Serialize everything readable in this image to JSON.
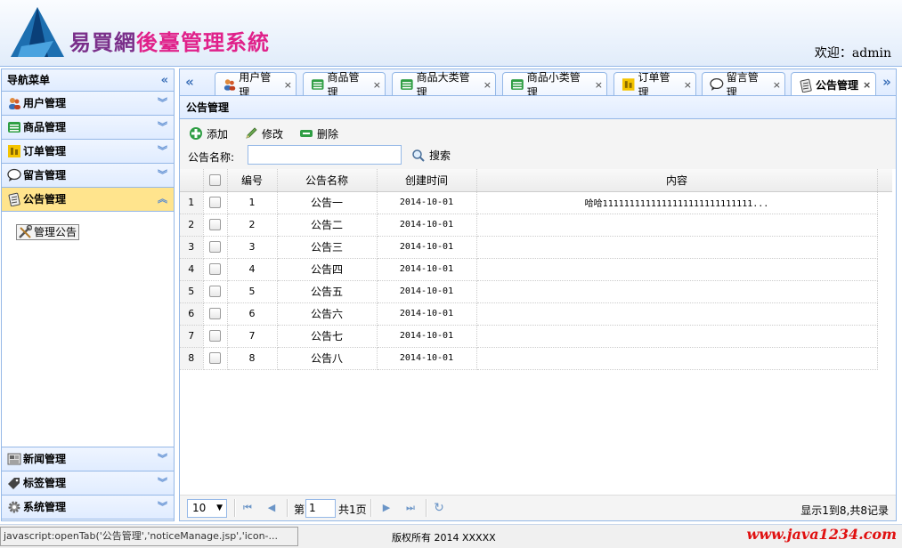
{
  "header": {
    "title_part1": "易買網",
    "title_part2": "後臺管理系統",
    "welcome": "欢迎：admin"
  },
  "sidebar": {
    "title": "导航菜单",
    "collapse_icon": "double-left-chevron-icon",
    "items": [
      {
        "label": "用户管理",
        "icon": "users-icon",
        "color": "#d35a2c"
      },
      {
        "label": "商品管理",
        "icon": "list-icon",
        "color": "#2f9e44"
      },
      {
        "label": "订单管理",
        "icon": "order-icon",
        "color": "#e6b800"
      },
      {
        "label": "留言管理",
        "icon": "speech-bubble-icon",
        "color": "#333333"
      },
      {
        "label": "公告管理",
        "icon": "notepad-icon",
        "color": "#555555",
        "selected": true
      },
      {
        "label": "新闻管理",
        "icon": "news-icon",
        "color": "#666666"
      },
      {
        "label": "标签管理",
        "icon": "tag-icon",
        "color": "#444444"
      },
      {
        "label": "系统管理",
        "icon": "gear-icon",
        "color": "#777777"
      }
    ],
    "tree_node": {
      "label": "管理公告",
      "icon": "tools-icon"
    }
  },
  "tabs": [
    {
      "label": "用户管理",
      "icon": "users-icon"
    },
    {
      "label": "商品管理",
      "icon": "list-icon"
    },
    {
      "label": "商品大类管理",
      "icon": "list-icon"
    },
    {
      "label": "商品小类管理",
      "icon": "list-icon"
    },
    {
      "label": "订单管理",
      "icon": "order-icon"
    },
    {
      "label": "留言管理",
      "icon": "speech-bubble-icon"
    },
    {
      "label": "公告管理",
      "icon": "notepad-icon",
      "active": true
    }
  ],
  "main": {
    "title": "公告管理",
    "toolbar": {
      "add_label": "添加",
      "edit_label": "修改",
      "delete_label": "删除",
      "search_label": "公告名称:",
      "search_value": "",
      "search_button": "搜索"
    },
    "grid": {
      "columns": [
        "编号",
        "公告名称",
        "创建时间",
        "内容"
      ],
      "rows": [
        {
          "rownum": "1",
          "id": "1",
          "name": "公告一",
          "date": "2014-10-01",
          "content": "哈哈1111111111111111111111111111..."
        },
        {
          "rownum": "2",
          "id": "2",
          "name": "公告二",
          "date": "2014-10-01",
          "content": ""
        },
        {
          "rownum": "3",
          "id": "3",
          "name": "公告三",
          "date": "2014-10-01",
          "content": ""
        },
        {
          "rownum": "4",
          "id": "4",
          "name": "公告四",
          "date": "2014-10-01",
          "content": ""
        },
        {
          "rownum": "5",
          "id": "5",
          "name": "公告五",
          "date": "2014-10-01",
          "content": ""
        },
        {
          "rownum": "6",
          "id": "6",
          "name": "公告六",
          "date": "2014-10-01",
          "content": ""
        },
        {
          "rownum": "7",
          "id": "7",
          "name": "公告七",
          "date": "2014-10-01",
          "content": ""
        },
        {
          "rownum": "8",
          "id": "8",
          "name": "公告八",
          "date": "2014-10-01",
          "content": ""
        }
      ]
    },
    "pager": {
      "page_size": "10",
      "page_prefix": "第",
      "page_value": "1",
      "page_suffix": "共1页",
      "info": "显示1到8,共8记录"
    }
  },
  "statusbar": {
    "url": "javascript:openTab('公告管理','noticeManage.jsp','icon-...",
    "copyright": "版权所有 2014 XXXXX",
    "watermark": "www.java1234.com"
  }
}
